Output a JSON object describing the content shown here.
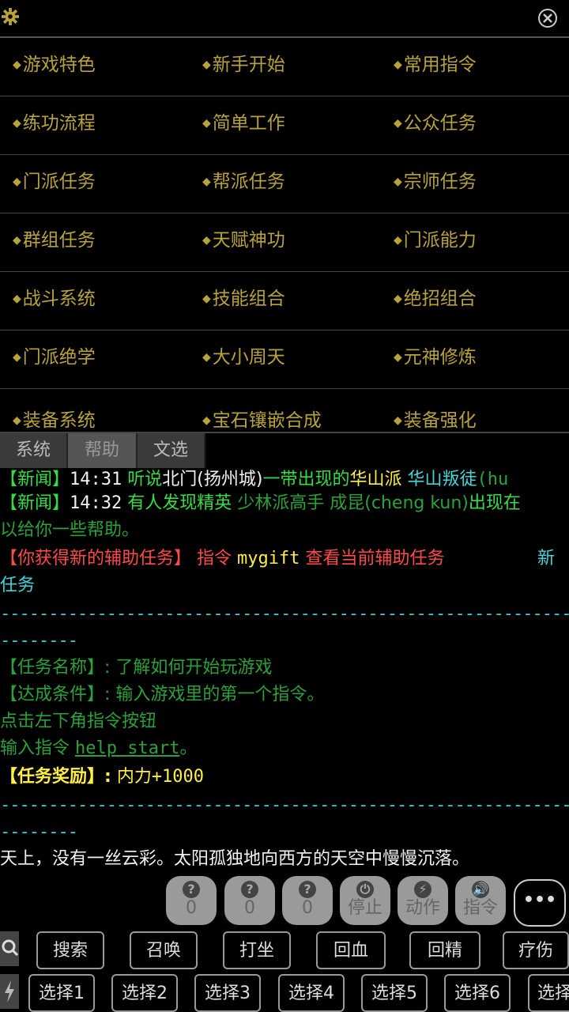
{
  "grid": {
    "rows": [
      [
        "游戏特色",
        "新手开始",
        "常用指令"
      ],
      [
        "练功流程",
        "简单工作",
        "公众任务"
      ],
      [
        "门派任务",
        "帮派任务",
        "宗师任务"
      ],
      [
        "群组任务",
        "天赋神功",
        "门派能力"
      ],
      [
        "战斗系统",
        "技能组合",
        "绝招组合"
      ],
      [
        "门派绝学",
        "大小周天",
        "元神修炼"
      ],
      [
        "装备系统",
        "宝石镶嵌合成",
        "装备强化"
      ]
    ]
  },
  "tabs": [
    "系统",
    "帮助",
    "文选"
  ],
  "log": {
    "l1": {
      "a": "【新闻】",
      "b": "14:31",
      "c": "听说",
      "d": "北门(扬州城)",
      "e": "一带出现的",
      "f": "华山派",
      "g": "华山叛徒",
      "h": "(hu"
    },
    "l2": {
      "a": "【新闻】",
      "b": "14:32",
      "c": "有人发现精英",
      "d": "少林派高手",
      "e": "成昆(cheng kun)",
      "f": "出现在"
    },
    "l3": "以给你一些帮助。",
    "l4": {
      "a": "【你获得新的辅助任务】",
      "b": "指令",
      "c": "mygift",
      "d": "查看当前辅助任务",
      "e": "新"
    },
    "l5": "任务",
    "dash1": "----------------------------------------------------------------",
    "dash2": "--------",
    "l6": "【任务名称】: 了解如何开始玩游戏",
    "l7": "【达成条件】: 输入游戏里的第一个指令。",
    "l8": "点击左下角指令按钮",
    "l9": {
      "a": "输入指令",
      "b": "help start",
      "c": "。"
    },
    "l10": {
      "a": "【任务奖励】:",
      "b": "内力+1000"
    },
    "dash3": "----------------------------------------------------------------",
    "dash4": "--------",
    "l11": "天上，没有一丝云彩。太阳孤独地向西方的天空中慢慢沉落。"
  },
  "roundButtons": [
    {
      "icon": "?",
      "label": "0"
    },
    {
      "icon": "?",
      "label": "0"
    },
    {
      "icon": "?",
      "label": "0"
    },
    {
      "icon": "⏻",
      "label": "停止"
    },
    {
      "icon": "⚡",
      "label": "动作"
    },
    {
      "icon": "🔊",
      "label": "指令"
    }
  ],
  "more": "•••",
  "row1": [
    "搜索",
    "召唤",
    "打坐",
    "回血",
    "回精",
    "疗伤"
  ],
  "row2": [
    "选择1",
    "选择2",
    "选择3",
    "选择4",
    "选择5",
    "选择6",
    "选择"
  ]
}
